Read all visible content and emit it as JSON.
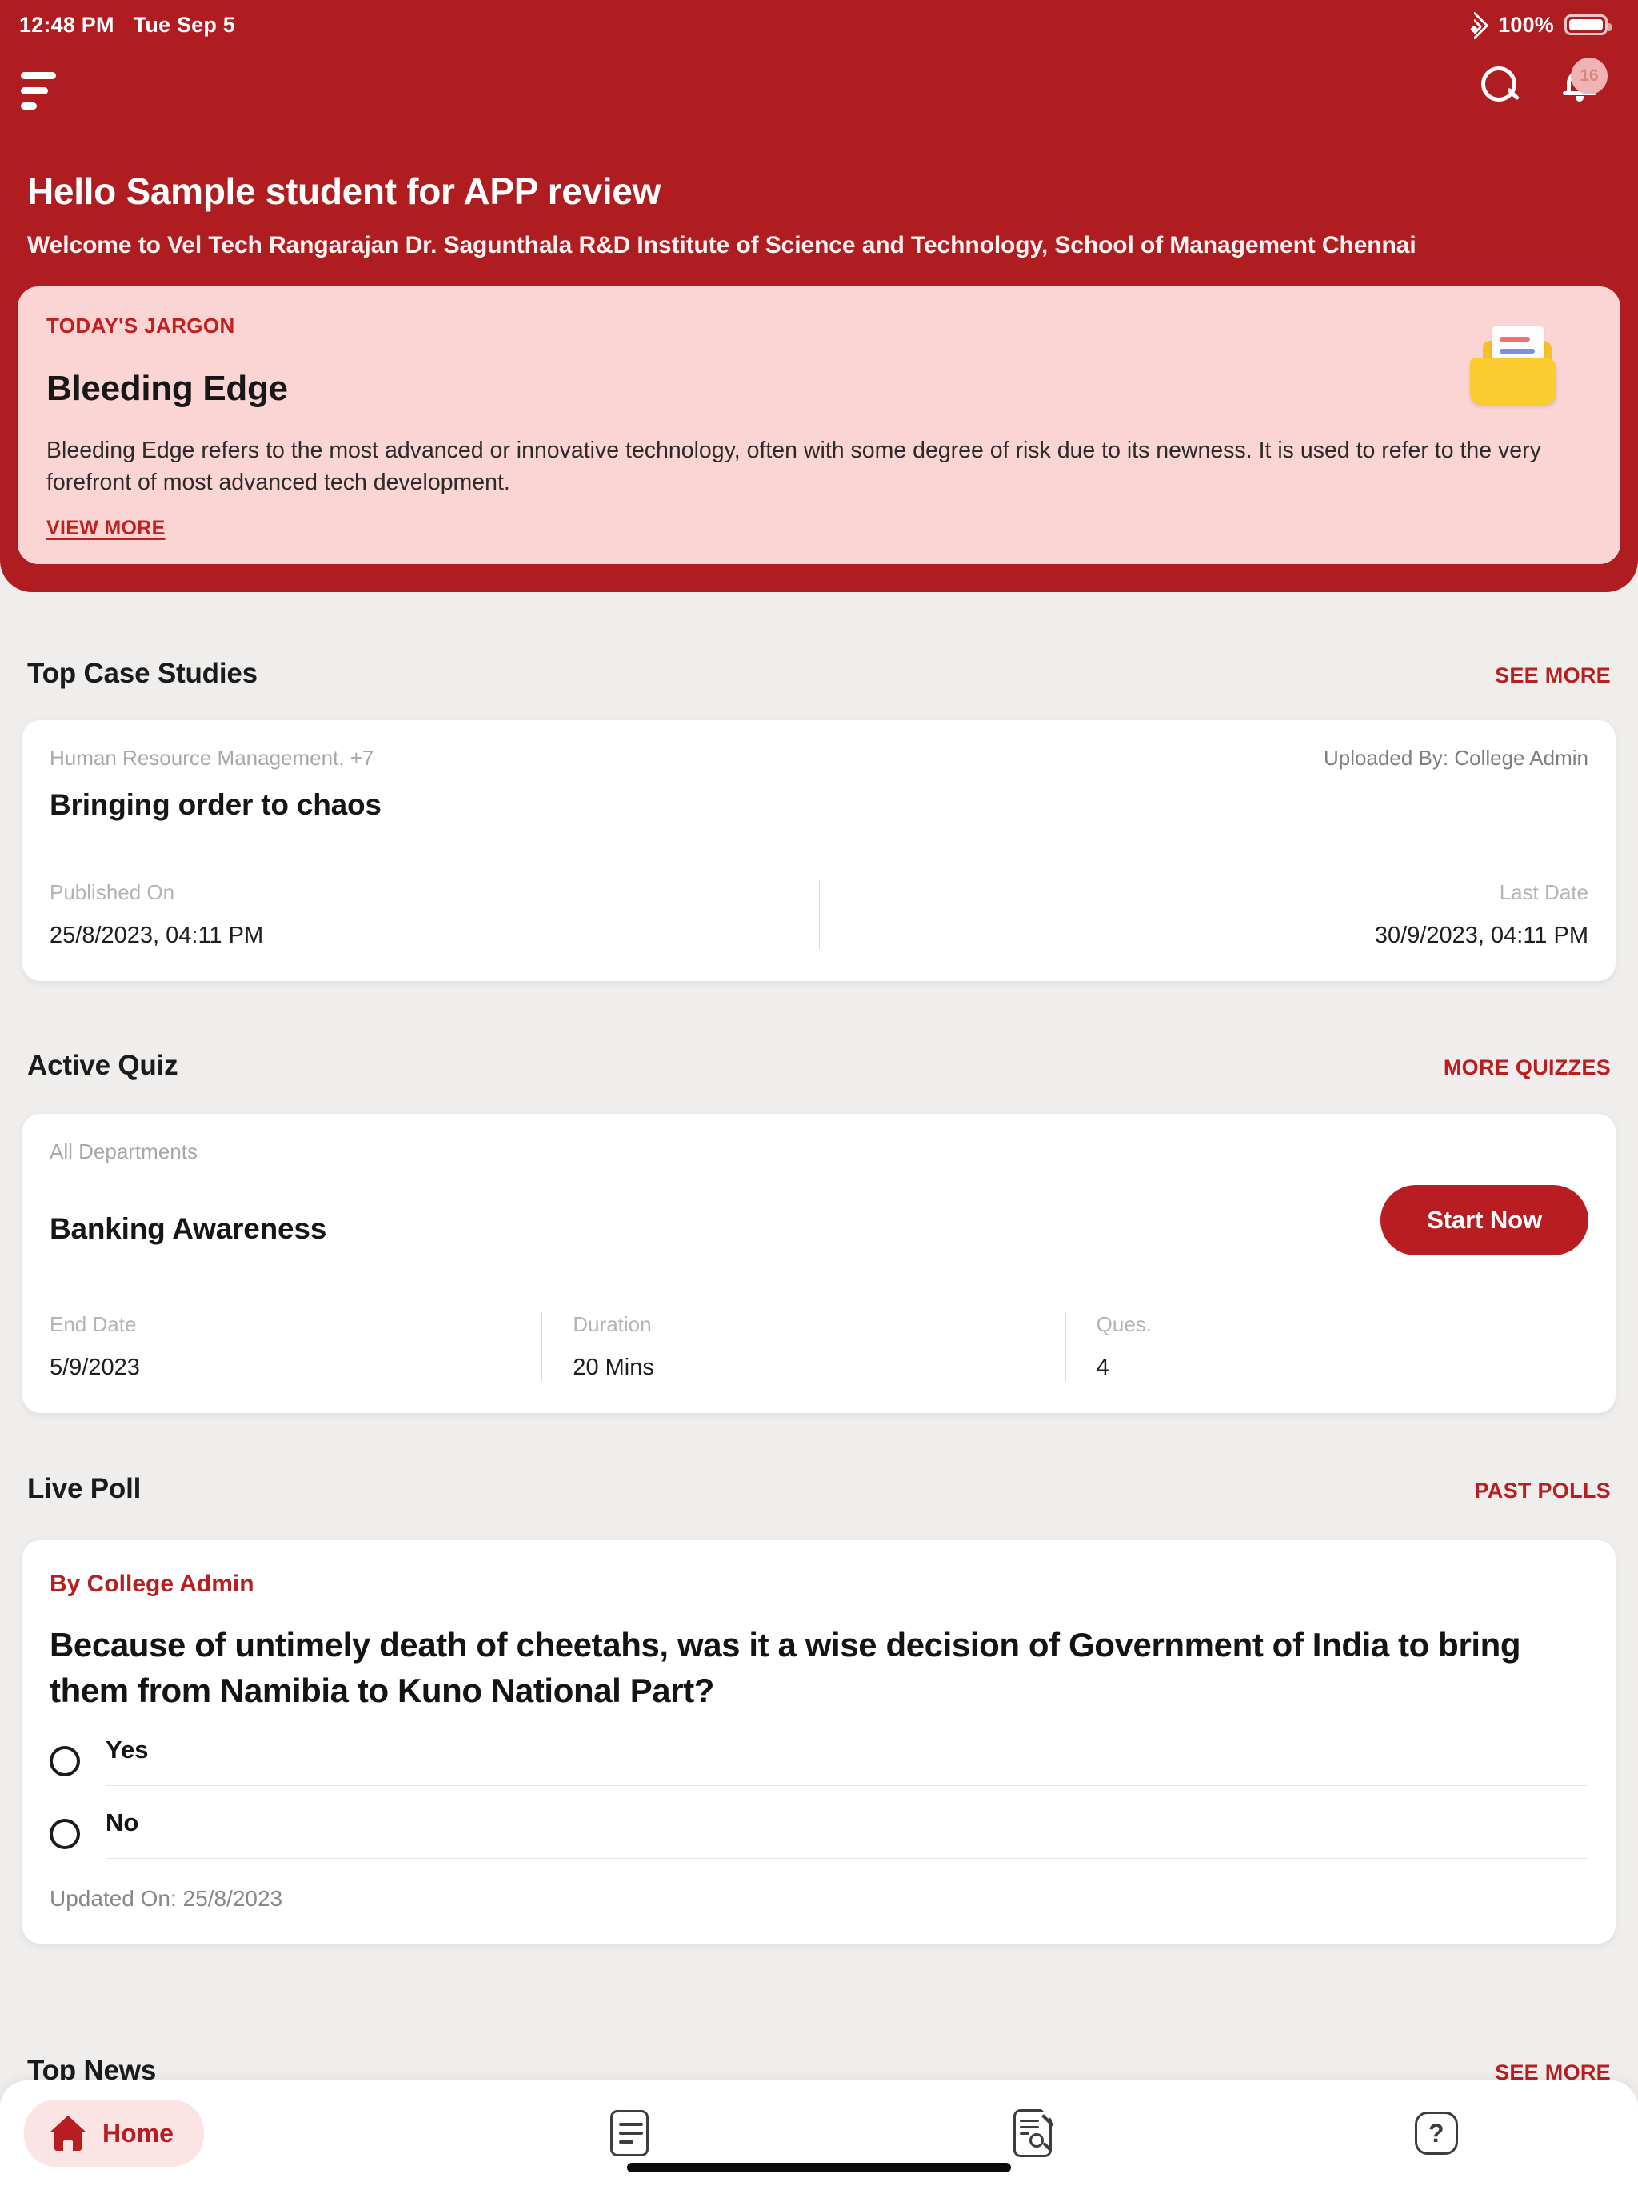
{
  "status_bar": {
    "time": "12:48 PM",
    "date": "Tue Sep 5",
    "battery_percent": "100%",
    "wifi_icon": "wifi-icon",
    "battery_icon": "battery-full-icon"
  },
  "header": {
    "menu_icon": "hamburger-menu-icon",
    "search_icon": "search-icon",
    "notification_icon": "bell-icon",
    "notification_count": "16",
    "greeting": "Hello Sample student for APP review",
    "welcome": "Welcome to Vel Tech Rangarajan Dr. Sagunthala R&D Institute of Science and Technology, School of Management Chennai",
    "brand_color": "#af1d20"
  },
  "jargon_card": {
    "label": "TODAY'S JARGON",
    "title": "Bleeding Edge",
    "description": "Bleeding Edge refers to the most advanced or innovative technology, often with some degree of risk due to its newness. It is used to refer to the very forefront of most advanced tech development.",
    "view_more": "VIEW MORE",
    "illustration_icon": "folder-document-icon",
    "background_color": "#fbd5d4",
    "accent_color": "#c0201f"
  },
  "case_studies": {
    "section_title": "Top Case Studies",
    "see_more": "SEE MORE",
    "item": {
      "departments": "Human Resource Management, +7",
      "uploaded_by": "Uploaded By: College Admin",
      "title": "Bringing order to chaos",
      "published_on_label": "Published On",
      "published_on_value": "25/8/2023, 04:11 PM",
      "last_date_label": "Last Date",
      "last_date_value": "30/9/2023, 04:11 PM"
    }
  },
  "active_quiz": {
    "section_title": "Active Quiz",
    "more_link": "MORE QUIZZES",
    "item": {
      "departments": "All Departments",
      "title": "Banking Awareness",
      "start_button": "Start Now",
      "end_date_label": "End Date",
      "end_date_value": "5/9/2023",
      "duration_label": "Duration",
      "duration_value": "20 Mins",
      "questions_label": "Ques.",
      "questions_value": "4"
    }
  },
  "live_poll": {
    "section_title": "Live Poll",
    "past_polls": "PAST POLLS",
    "author": "By College Admin",
    "question": "Because of untimely death of cheetahs, was it a wise decision of Government of India to bring them from Namibia to Kuno National Part?",
    "options": [
      {
        "label": "Yes"
      },
      {
        "label": "No"
      }
    ],
    "updated_on": "Updated On: 25/8/2023"
  },
  "top_news": {
    "section_title": "Top News",
    "see_more": "SEE MORE"
  },
  "bottom_nav": {
    "items": [
      {
        "label": "Home",
        "icon": "home-icon",
        "active": true
      },
      {
        "label": "",
        "icon": "article-list-icon",
        "active": false
      },
      {
        "label": "",
        "icon": "case-study-search-icon",
        "active": false
      },
      {
        "label": "",
        "icon": "help-question-icon",
        "active": false
      }
    ],
    "active_color": "#b81d21",
    "active_pill_color": "#fbe4e4"
  }
}
